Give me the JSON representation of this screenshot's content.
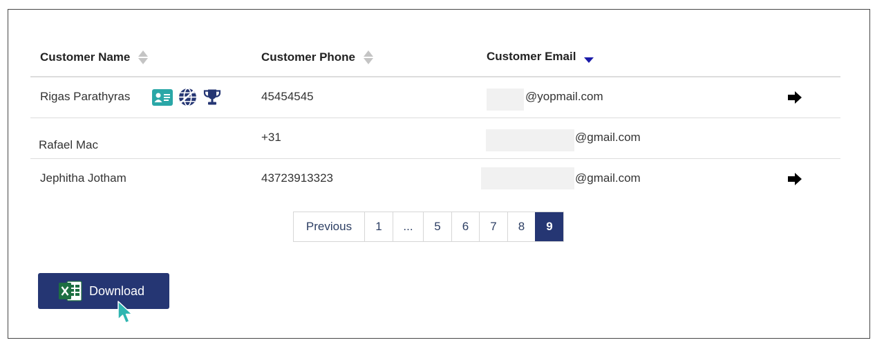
{
  "table": {
    "headers": {
      "name": "Customer Name",
      "phone": "Customer Phone",
      "email": "Customer Email"
    },
    "rows": [
      {
        "name": "Rigas Parathyras",
        "phone": "45454545",
        "email": "@yopmail.com"
      },
      {
        "name": "Rafael Mac",
        "phone": "+31",
        "email": "@gmail.com"
      },
      {
        "name": "Jephitha Jotham",
        "phone": "43723913323",
        "email": "@gmail.com"
      }
    ]
  },
  "pagination": {
    "previous": "Previous",
    "pages": [
      "1",
      "...",
      "5",
      "6",
      "7",
      "8",
      "9"
    ],
    "current": "9"
  },
  "download": {
    "label": "Download"
  },
  "icons": {
    "row1": [
      "id-card-icon",
      "globe-icon",
      "trophy-icon"
    ],
    "row_action": "arrow-right-icon",
    "download": "excel-icon",
    "cursor": "mouse-pointer-icon"
  },
  "colors": {
    "primary": "#253673",
    "teal": "#2aa7a7",
    "sort_active": "#1a1aa8",
    "sort_inactive": "#c4c4c4",
    "excel_green": "#1d6f42"
  }
}
